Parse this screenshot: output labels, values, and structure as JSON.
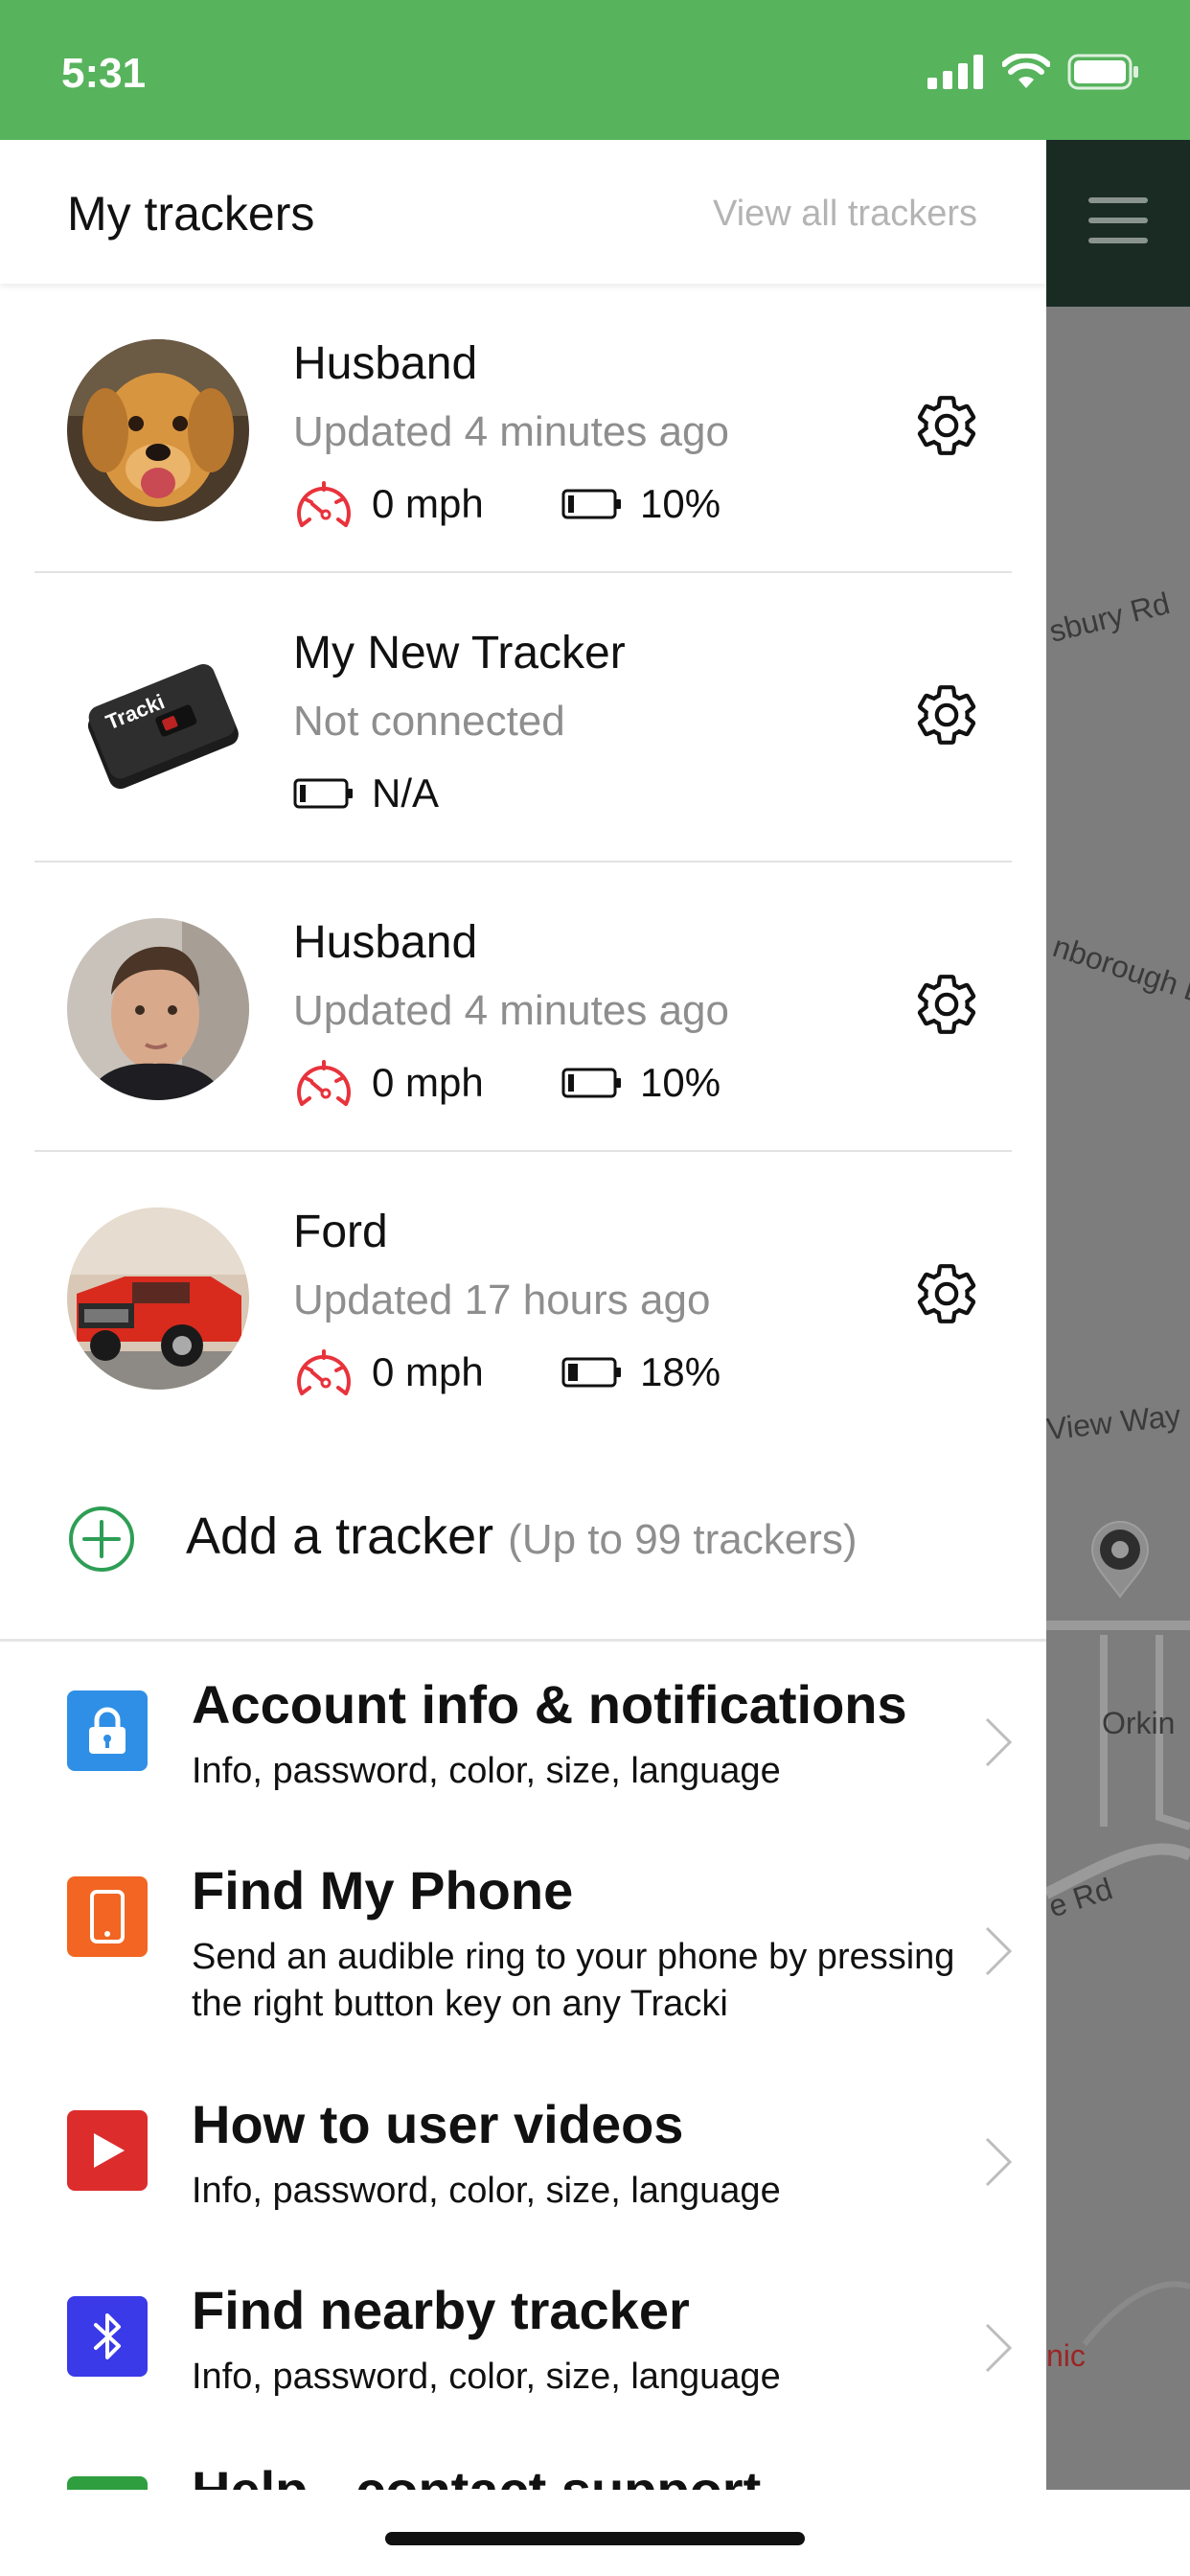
{
  "status_bar": {
    "time": "5:31",
    "color": "#57b35c"
  },
  "drawer": {
    "title": "My trackers",
    "view_all": "View all trackers",
    "trackers": [
      {
        "name": "Husband",
        "status": "Updated 4 minutes ago",
        "speed": "0 mph",
        "battery": "10%",
        "avatar": "dog-photo"
      },
      {
        "name": "My New Tracker",
        "status": "Not connected",
        "battery": "N/A",
        "avatar": "tracker-device"
      },
      {
        "name": "Husband",
        "status": "Updated 4 minutes ago",
        "speed": "0 mph",
        "battery": "10%",
        "avatar": "man-photo"
      },
      {
        "name": "Ford",
        "status": "Updated 17 hours ago",
        "speed": "0 mph",
        "battery": "18%",
        "avatar": "red-truck-photo"
      }
    ],
    "add_tracker": {
      "label": "Add a tracker",
      "note": "(Up to 99 trackers)"
    },
    "menu": [
      {
        "title": "Account info & notifications",
        "subtitle": "Info, password, color, size, language",
        "icon": "lock-icon",
        "color": "#2f8fe6"
      },
      {
        "title": "Find My Phone",
        "subtitle": "Send an audible ring to your phone by pressing the right button key on any Tracki",
        "icon": "phone-icon",
        "color": "#f26522"
      },
      {
        "title": "How to user videos",
        "subtitle": "Info, password, color, size, language",
        "icon": "play-icon",
        "color": "#dd2c2c"
      },
      {
        "title": "Find nearby tracker",
        "subtitle": "Info, password, color, size, language",
        "icon": "bluetooth-icon",
        "color": "#3a3ae8"
      },
      {
        "title": "Help - contact support",
        "icon": "help-icon",
        "color": "#2e9e3e"
      }
    ]
  },
  "map": {
    "labels": [
      "sbury Rd",
      "nborough D",
      "View Way",
      "Orkin",
      "e Rd",
      "nic"
    ]
  },
  "device_label": "Tracki"
}
